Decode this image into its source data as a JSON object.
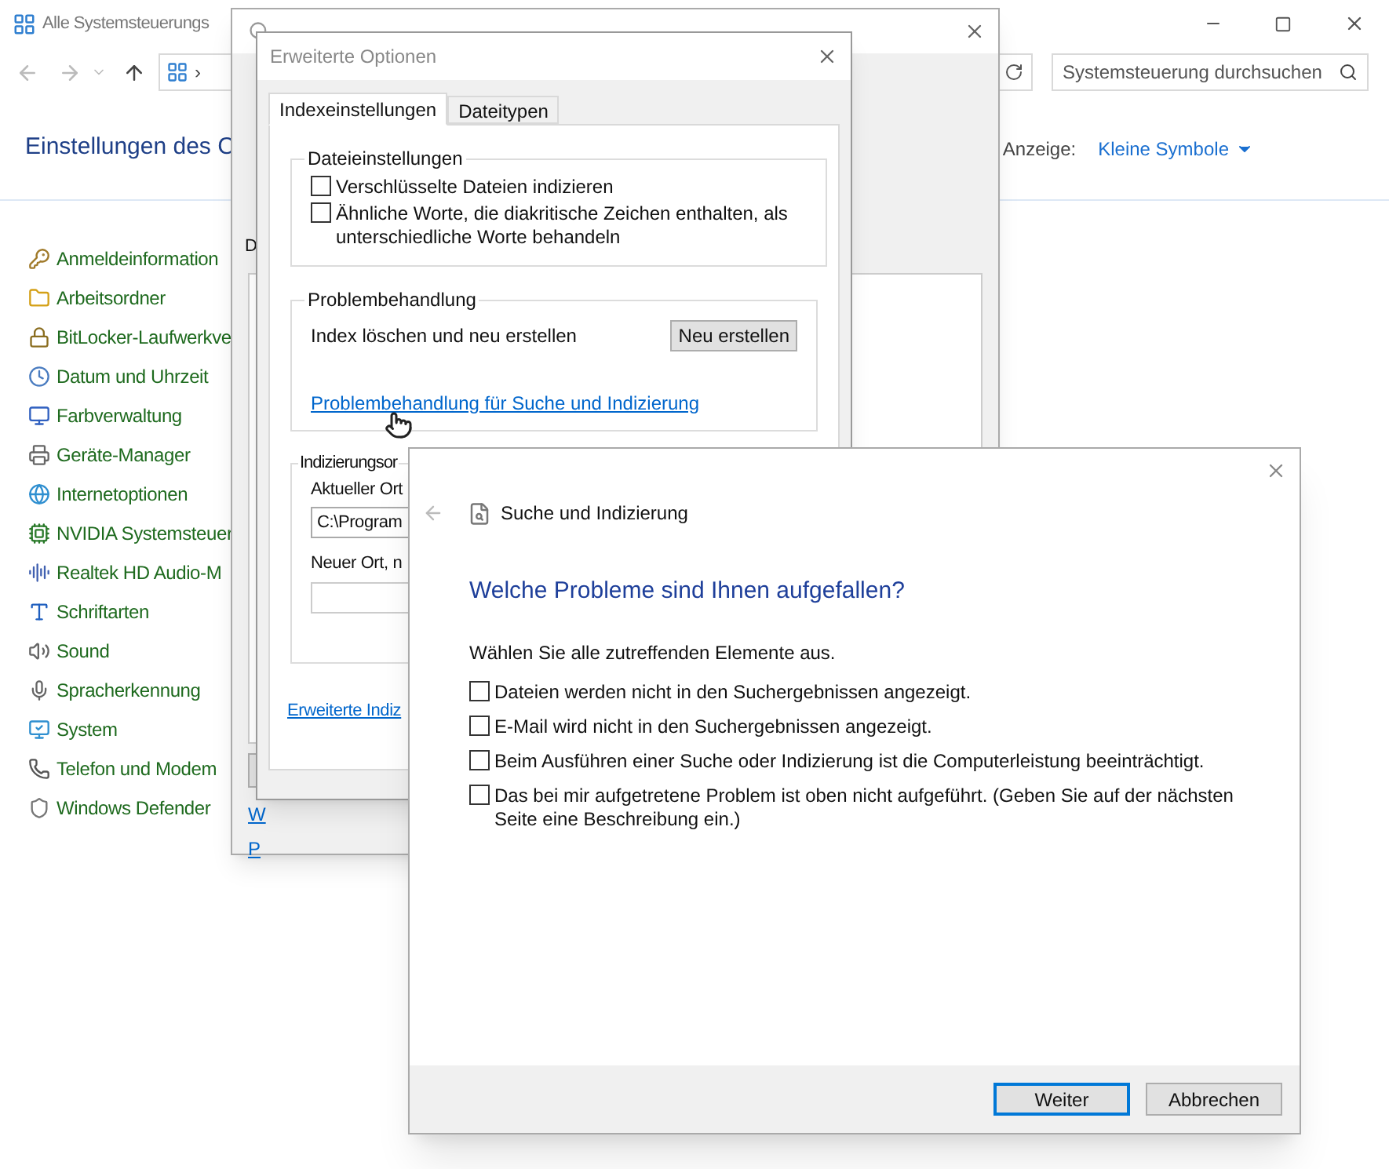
{
  "control_panel": {
    "title": "Alle Systemsteuerungs",
    "address_crumb": "›",
    "search": {
      "placeholder": "Systemsteuerung durchsuchen"
    },
    "heading": "Einstellungen des C",
    "view_label": "Anzeige:",
    "view_value": "Kleine Symbole",
    "items": [
      "Anmeldeinformation",
      "Arbeitsordner",
      "BitLocker-Laufwerkve",
      "Datum und Uhrzeit",
      "Farbverwaltung",
      "Geräte-Manager",
      "Internetoptionen",
      "NVIDIA Systemsteuer",
      "Realtek HD Audio-M",
      "Schriftarten",
      "Sound",
      "Spracherkennung",
      "System",
      "Telefon und Modem",
      "Windows Defender"
    ]
  },
  "indexing_options": {
    "label": "D",
    "links": [
      "W",
      "P"
    ]
  },
  "advanced_options": {
    "title": "Erweiterte Optionen",
    "tabs": [
      {
        "label": "Indexeinstellungen",
        "selected": true
      },
      {
        "label": "Dateitypen",
        "selected": false
      }
    ],
    "file_settings": {
      "title": "Dateieinstellungen",
      "options": [
        {
          "label": "Verschlüsselte Dateien indizieren",
          "checked": false
        },
        {
          "label": "Ähnliche Worte, die diakritische Zeichen enthalten, als unterschiedliche Worte behandeln",
          "checked": false
        }
      ]
    },
    "troubleshooting": {
      "title": "Problembehandlung",
      "text": "Index löschen und neu erstellen",
      "button": "Neu erstellen",
      "link": "Problembehandlung für Suche und Indizierung"
    },
    "index_location": {
      "title": "Indizierungsor",
      "current_label": "Aktueller Ort",
      "current_value": "C:\\Program",
      "new_label": "Neuer Ort, n"
    },
    "advanced_link": "Erweiterte Indiz"
  },
  "troubleshooter": {
    "app_title": "Suche und Indizierung",
    "heading": "Welche Probleme sind Ihnen aufgefallen?",
    "instruction": "Wählen Sie alle zutreffenden Elemente aus.",
    "problems": [
      {
        "label": "Dateien werden nicht in den Suchergebnissen angezeigt.",
        "checked": false
      },
      {
        "label": "E-Mail wird nicht in den Suchergebnissen angezeigt.",
        "checked": false
      },
      {
        "label": "Beim Ausführen einer Suche oder Indizierung ist die Computerleistung beeinträchtigt.",
        "checked": false
      },
      {
        "label": "Das bei mir aufgetretene Problem ist oben nicht aufgeführt. (Geben Sie auf der nächsten Seite eine Beschreibung ein.)",
        "checked": false
      }
    ],
    "buttons": [
      {
        "label": "Weiter",
        "default": true
      },
      {
        "label": "Abbrechen",
        "default": false
      }
    ]
  }
}
